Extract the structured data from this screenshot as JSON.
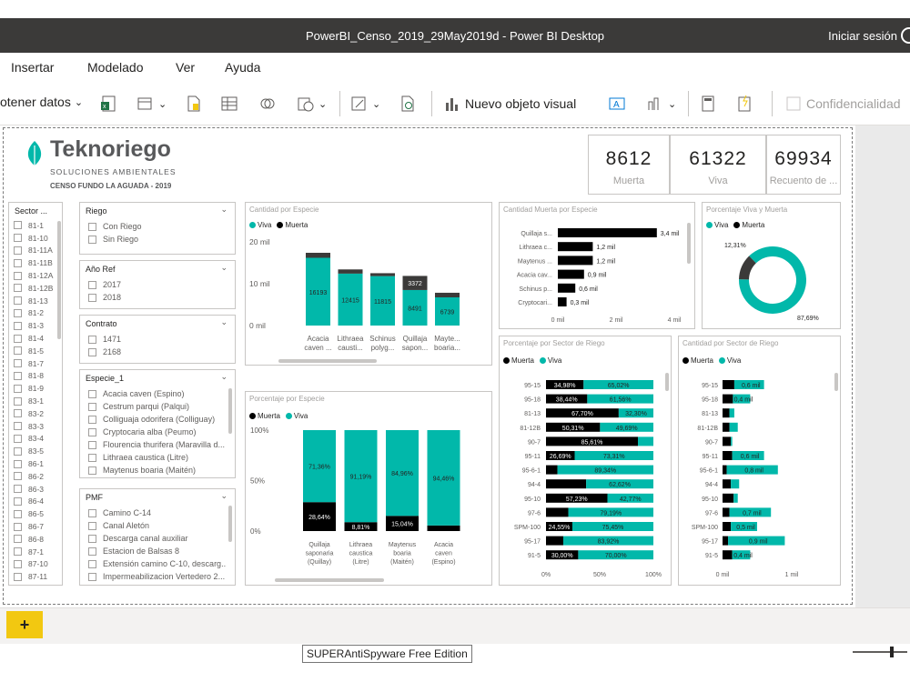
{
  "window": {
    "title": "PowerBI_Censo_2019_29May2019d - Power BI Desktop",
    "signin": "Iniciar sesión"
  },
  "menu": {
    "items": [
      "Insertar",
      "Modelado",
      "Ver",
      "Ayuda"
    ]
  },
  "ribbon": {
    "get_data": "otener datos",
    "new_visual": "Nuevo objeto visual",
    "confidential": "Confidencialidad"
  },
  "logo": {
    "name": "Teknoriego",
    "sub": "SOLUCIONES AMBIENTALES",
    "sub2": "CENSO FUNDO LA AGUADA - 2019"
  },
  "kpis": [
    {
      "value": "8612",
      "label": "Muerta"
    },
    {
      "value": "61322",
      "label": "Viva"
    },
    {
      "value": "69934",
      "label": "Recuento de ..."
    }
  ],
  "slicers": {
    "sector": {
      "title": "Sector ...",
      "items": [
        "81-1",
        "81-10",
        "81-11A",
        "81-11B",
        "81-12A",
        "81-12B",
        "81-13",
        "81-2",
        "81-3",
        "81-4",
        "81-5",
        "81-7",
        "81-8",
        "81-9",
        "83-1",
        "83-2",
        "83-3",
        "83-4",
        "83-5",
        "86-1",
        "86-2",
        "86-3",
        "86-4",
        "86-5",
        "86-7",
        "86-8",
        "87-1",
        "87-10",
        "87-11"
      ]
    },
    "riego": {
      "title": "Riego",
      "items": [
        "Con Riego",
        "Sin Riego"
      ]
    },
    "anio": {
      "title": "Año Ref",
      "items": [
        "2017",
        "2018"
      ]
    },
    "contrato": {
      "title": "Contrato",
      "items": [
        "1471",
        "2168"
      ]
    },
    "especie": {
      "title": "Especie_1",
      "items": [
        "Acacia caven (Espino)",
        "Cestrum parqui (Palqui)",
        "Colliguaja odorifera (Colliguay)",
        "Cryptocaria alba (Peumo)",
        "Flourencia thurifera (Maravilla d...",
        "Lithraea caustica (Litre)",
        "Maytenus boaria (Maitén)"
      ]
    },
    "pmf": {
      "title": "PMF",
      "items": [
        "Camino C-14",
        "Canal Aletón",
        "Descarga canal auxiliar",
        "Estacion de Balsas 8",
        "Extensión camino C-10, descarg...",
        "Impermeabilizacion Vertedero 2..."
      ]
    }
  },
  "colors": {
    "viva": "#01b8aa",
    "muerta": "#000000",
    "accent": "#f2c811"
  },
  "legend": {
    "viva": "Viva",
    "muerta": "Muerta"
  },
  "charts": {
    "cantidad_especie": {
      "title": "Cantidad por Especie",
      "type": "bar",
      "categories": [
        "Acacia caven ...",
        "Lithraea causti...",
        "Schinus polyg...",
        "Quillaja sapon...",
        "Mayte... boaria..."
      ],
      "cat_lines": [
        [
          "Acacia",
          "caven ..."
        ],
        [
          "Lithraea",
          "causti..."
        ],
        [
          "Schinus",
          "polyg..."
        ],
        [
          "Quillaja",
          "sapon..."
        ],
        [
          "Mayte...",
          "boaria..."
        ]
      ],
      "viva": [
        16193,
        12415,
        11815,
        8491,
        6739
      ],
      "muerta": [
        1200,
        1000,
        700,
        3372,
        1100
      ],
      "labels_viva": [
        "16193",
        "12415",
        "11815",
        "8491",
        "6739"
      ],
      "labels_muerta": [
        "",
        "",
        "",
        "3372",
        ""
      ],
      "yticks": [
        "20 mil",
        "10 mil",
        "0 mil"
      ],
      "ylim": [
        0,
        20000
      ]
    },
    "cantidad_muerta": {
      "title": "Cantidad Muerta por Especie",
      "type": "bar",
      "categories": [
        "Quillaja s...",
        "Lithraea c...",
        "Maytenus ...",
        "Acacia cav...",
        "Schinus p...",
        "Cryptocari..."
      ],
      "values": [
        3.4,
        1.2,
        1.2,
        0.9,
        0.6,
        0.3
      ],
      "labels": [
        "3,4 mil",
        "1,2 mil",
        "1,2 mil",
        "0,9 mil",
        "0,6 mil",
        "0,3 mil"
      ],
      "xticks": [
        "0 mil",
        "2 mil",
        "4 mil"
      ],
      "xlim": [
        0,
        4
      ]
    },
    "porcentaje_viva_muerta": {
      "title": "Porcentaje Viva y Muerta",
      "type": "pie",
      "values": [
        87.69,
        12.31
      ],
      "labels": [
        "87,69%",
        "12,31%"
      ]
    },
    "porcentaje_especie": {
      "title": "Porcentaje por Especie",
      "type": "bar",
      "categories": [
        "Quillaja saponaria (Quillay)",
        "Lithraea caustica (Litre)",
        "Maytenus boaria (Maitén)",
        "Acacia caven (Espino)"
      ],
      "cat_lines": [
        [
          "Quillaja",
          "saponaria",
          "(Quillay)"
        ],
        [
          "Lithraea",
          "caustica",
          "(Litre)"
        ],
        [
          "Maytenus",
          "boaria",
          "(Maitén)"
        ],
        [
          "Acacia",
          "caven",
          "(Espino)"
        ]
      ],
      "viva": [
        71.36,
        91.19,
        84.96,
        94.46
      ],
      "muerta": [
        28.64,
        8.81,
        15.04,
        5.54
      ],
      "labels_viva": [
        "71,36%",
        "91,19%",
        "84,96%",
        "94,46%"
      ],
      "labels_muerta": [
        "28,64%",
        "8,81%",
        "15,04%",
        ""
      ],
      "yticks": [
        "100%",
        "50%",
        "0%"
      ]
    },
    "porcentaje_sector": {
      "title": "Porcentaje por Sector de Riego",
      "type": "bar",
      "categories": [
        "95-15",
        "95-18",
        "81-13",
        "81-12B",
        "90-7",
        "95-11",
        "95-6-1",
        "94-4",
        "95-10",
        "97-6",
        "SPM-100",
        "95-17",
        "91-5"
      ],
      "muerta": [
        34.98,
        38.44,
        67.7,
        50.31,
        85.61,
        26.69,
        10.66,
        37.38,
        57.23,
        20.81,
        24.55,
        16.08,
        30.0
      ],
      "viva": [
        65.02,
        61.56,
        32.3,
        49.69,
        14.39,
        73.31,
        89.34,
        62.62,
        42.77,
        79.19,
        75.45,
        83.92,
        70.0
      ],
      "labels_muerta": [
        "34,98%",
        "38,44%",
        "67,70%",
        "50,31%",
        "85,61%",
        "26,69%",
        "",
        "",
        "57,23%",
        "",
        "24,55%",
        "",
        "30,00%"
      ],
      "labels_viva": [
        "65,02%",
        "61,56%",
        "32,30%",
        "49,69%",
        "",
        "73,31%",
        "89,34%",
        "62,62%",
        "42,77%",
        "79,19%",
        "75,45%",
        "83,92%",
        "70,00%"
      ],
      "xticks": [
        "0%",
        "50%",
        "100%"
      ]
    },
    "cantidad_sector": {
      "title": "Cantidad por Sector de Riego",
      "type": "bar",
      "categories": [
        "95-15",
        "95-18",
        "81-13",
        "81-12B",
        "90-7",
        "95-11",
        "95-6-1",
        "94-4",
        "95-10",
        "97-6",
        "SPM-100",
        "95-17",
        "91-5"
      ],
      "muerta": [
        0.17,
        0.15,
        0.1,
        0.1,
        0.12,
        0.14,
        0.06,
        0.12,
        0.16,
        0.1,
        0.12,
        0.08,
        0.14
      ],
      "viva": [
        0.43,
        0.25,
        0.07,
        0.12,
        0.02,
        0.46,
        0.74,
        0.12,
        0.06,
        0.6,
        0.38,
        0.82,
        0.26
      ],
      "labels": [
        "0,6 mil",
        "0,4 mil",
        "",
        "",
        "",
        "0,6 mil",
        "0,8 mil",
        "",
        "",
        "0,7 mil",
        "0,5 mil",
        "0,9 mil",
        "0,4 mil"
      ],
      "xticks": [
        "0 mil",
        "1 mil"
      ],
      "xlim": [
        0,
        1
      ]
    }
  },
  "bottom": {
    "add_page": "+",
    "tooltip": "SUPERAntiSpyware Free Edition"
  }
}
